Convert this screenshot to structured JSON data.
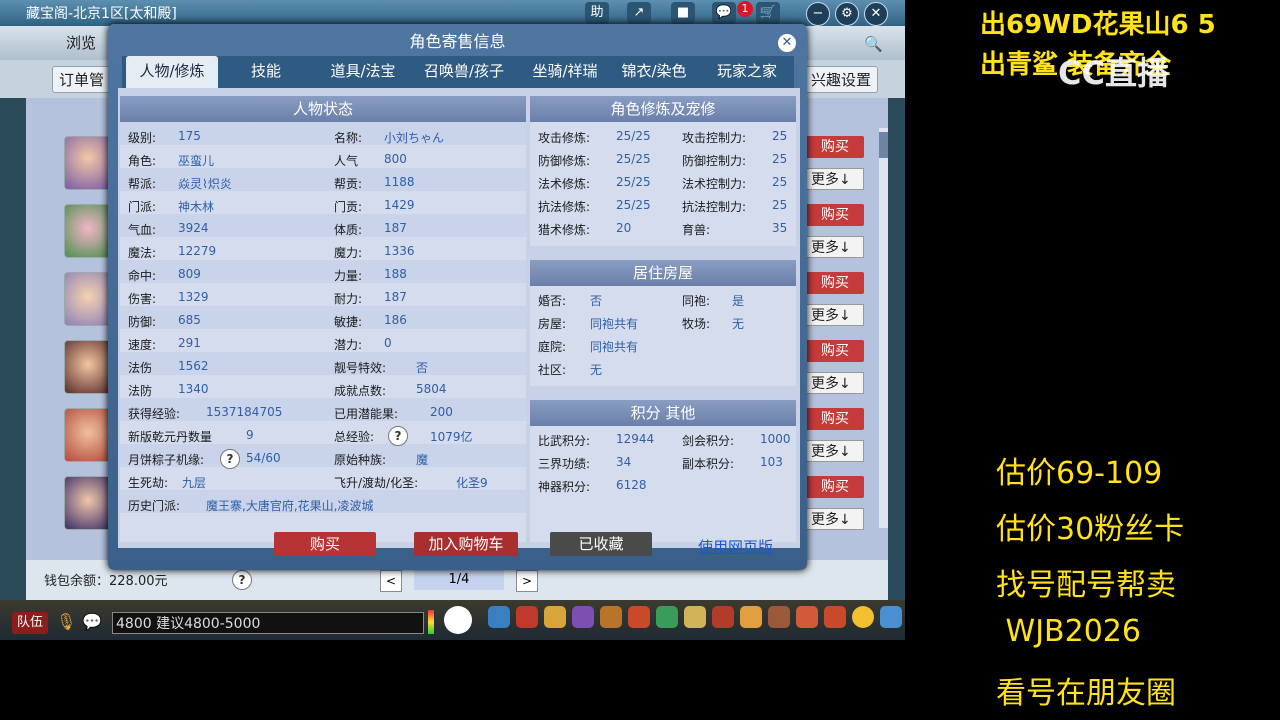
{
  "window": {
    "title": "藏宝阁-北京1区[太和殿]",
    "btn_help": "助",
    "notif_count": "1"
  },
  "nav": {
    "browse": "浏览",
    "orders": "订单管",
    "interest": "兴趣设置"
  },
  "list": {
    "buy_label": "购买",
    "more_label": "更多↓"
  },
  "dialog": {
    "title": "角色寄售信息",
    "tabs": [
      "人物/修炼",
      "技能",
      "道具/法宝",
      "召唤兽/孩子",
      "坐骑/祥瑞",
      "锦衣/染色",
      "玩家之家"
    ],
    "status_header": "人物状态",
    "status_left": [
      [
        "级别:",
        "175"
      ],
      [
        "角色:",
        "巫蛮儿"
      ],
      [
        "帮派:",
        "焱灵⌇炽炎"
      ],
      [
        "门派:",
        "神木林"
      ],
      [
        "气血:",
        "3924"
      ],
      [
        "魔法:",
        "12279"
      ],
      [
        "命中:",
        "809"
      ],
      [
        "伤害:",
        "1329"
      ],
      [
        "防御:",
        "685"
      ],
      [
        "速度:",
        "291"
      ],
      [
        "法伤",
        "1562"
      ],
      [
        "法防",
        "1340"
      ],
      [
        "获得经验:",
        "1537184705"
      ],
      [
        "新版乾元丹数量",
        "9"
      ]
    ],
    "status_right": [
      [
        "名称:",
        "小刘ちゃん"
      ],
      [
        "人气",
        "800"
      ],
      [
        "帮贡:",
        "1188"
      ],
      [
        "门贡:",
        "1429"
      ],
      [
        "体质:",
        "187"
      ],
      [
        "魔力:",
        "1336"
      ],
      [
        "力量:",
        "188"
      ],
      [
        "耐力:",
        "187"
      ],
      [
        "敏捷:",
        "186"
      ],
      [
        "潜力:",
        "0"
      ],
      [
        "靓号特效:",
        "否"
      ],
      [
        "成就点数:",
        "5804"
      ],
      [
        "已用潜能果:",
        "200"
      ]
    ],
    "total_exp_label": "总经验:",
    "total_exp_value": "1079亿",
    "mooncake_label": "月饼粽子机缘:",
    "mooncake_value": "54/60",
    "race_label": "原始种族:",
    "race_value": "魔",
    "life_label": "生死劫:",
    "life_value": "九层",
    "fly_label": "飞升/渡劫/化圣:",
    "fly_value": "化圣9",
    "history_label": "历史门派:",
    "history_value": "魔王寨,大唐官府,花果山,凌波城",
    "cult_header": "角色修炼及宠修",
    "cult": [
      [
        "攻击修炼:",
        "25/25",
        "攻击控制力:",
        "25"
      ],
      [
        "防御修炼:",
        "25/25",
        "防御控制力:",
        "25"
      ],
      [
        "法术修炼:",
        "25/25",
        "法术控制力:",
        "25"
      ],
      [
        "抗法修炼:",
        "25/25",
        "抗法控制力:",
        "25"
      ],
      [
        "猎术修炼:",
        "20",
        "育兽:",
        "35"
      ]
    ],
    "house_header": "居住房屋",
    "house": [
      [
        "婚否:",
        "否",
        "同袍:",
        "是"
      ],
      [
        "房屋:",
        "同袍共有",
        "牧场:",
        "无"
      ],
      [
        "庭院:",
        "同袍共有",
        "",
        ""
      ],
      [
        "社区:",
        "无",
        "",
        ""
      ]
    ],
    "score_header": "积分 其他",
    "score": [
      [
        "比武积分:",
        "12944",
        "剑会积分:",
        "1000"
      ],
      [
        "三界功绩:",
        "34",
        "副本积分:",
        "103"
      ],
      [
        "神器积分:",
        "6128",
        "",
        ""
      ]
    ],
    "buy_btn": "购买",
    "cart_btn": "加入购物车",
    "fav_btn": "已收藏",
    "web_link": "使用网页版",
    "help_q": "?"
  },
  "bottom": {
    "wallet": "钱包余额：228.00元",
    "page": "1/4"
  },
  "taskbar": {
    "team": "队伍",
    "chat": "4800  建议4800-5000"
  },
  "overlay": {
    "top_line1": "出69WD花果山6  5",
    "top_line2": "出青鲨 装备齐全",
    "cc_logo_text": "CC直播",
    "bottom_lines": [
      "估价69-109",
      "估价30粉丝卡",
      "找号配号帮卖",
      " WJB2026",
      "看号在朋友圈"
    ]
  },
  "colors": {
    "overlay_text": "#ffe21a",
    "buy_red": "#c53a3a",
    "link_blue": "#1c57d0",
    "value_blue": "#2f5fa8"
  }
}
